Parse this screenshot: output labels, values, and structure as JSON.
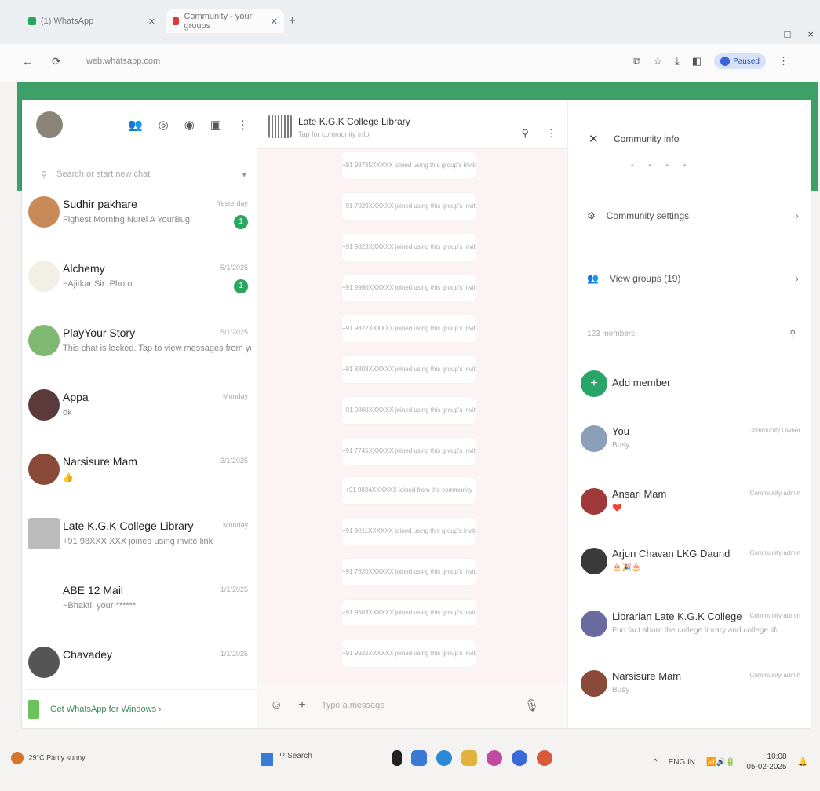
{
  "browser": {
    "tabs": [
      {
        "label": "(1) WhatsApp",
        "color": "#25a85c"
      },
      {
        "label": "Community - your groups",
        "color": "#d93a3a"
      }
    ],
    "new_tab": "+",
    "url": "web.whatsapp.com",
    "window_controls": [
      "–",
      "□",
      "×"
    ],
    "paused_label": "Paused"
  },
  "sidebar": {
    "search_placeholder": "Search or start new chat",
    "chats": [
      {
        "name": "Sudhir pakhare",
        "preview": "Fighest Morning Nurei A YourBug",
        "time": "Yesterday",
        "unread": "1",
        "avatar": "#c98a5a"
      },
      {
        "name": "Alchemy",
        "preview": "~Ajitkar Sir: Photo",
        "time": "5/1/2025",
        "unread": "1",
        "avatar": "#f2efe6"
      },
      {
        "name": "PlayYour Story",
        "preview": "This chat is locked. Tap to view messages from your system",
        "time": "5/1/2025",
        "unread": "",
        "avatar": "#7fb870"
      },
      {
        "name": "Appa",
        "preview": "ok",
        "time": "Monday",
        "unread": "",
        "avatar": "#5a3a3a"
      },
      {
        "name": "Narsisure Mam",
        "preview": "👍",
        "time": "3/1/2025",
        "unread": "",
        "avatar": "#8a4a3a"
      },
      {
        "name": "Late K.G.K College Library",
        "preview": "+91 98XXX XXX joined using invite link",
        "time": "Monday",
        "unread": "",
        "avatar": "#bbbbbb"
      },
      {
        "name": "ABE 12 Mail",
        "preview": "~Bhakti: your ******",
        "time": "1/1/2025",
        "unread": "",
        "avatar": "#ffffff"
      },
      {
        "name": "Chavadey",
        "preview": "",
        "time": "1/1/2025",
        "unread": "",
        "avatar": "#555555"
      }
    ],
    "get_app": "Get WhatsApp for Windows ›"
  },
  "conversation": {
    "title": "Late K.G.K College Library",
    "subtitle": "Tap for community info",
    "system_messages": [
      "+91 98765XXXXX joined using this group's invite link",
      "+91 7020XXXXXX joined using this group's invite link",
      "+91 9823XXXXXX joined using this group's invite link",
      "+91 9960XXXXXX joined using this group's invite link",
      "+91 9822XXXXXX joined using this group's invite link",
      "+91 8308XXXXXX joined using this group's invite link",
      "+91 9860XXXXXX joined using this group's invite link",
      "+91 7745XXXXXX joined using this group's invite link",
      "+91 9834XXXXXX joined from the community",
      "+91 9011XXXXXX joined using this group's invite link",
      "+91 7620XXXXXX joined using this group's invite link",
      "+91 9503XXXXXX joined using this group's invite link",
      "+91 9922XXXXXX joined using this group's invite link"
    ],
    "composer_placeholder": "Type a message"
  },
  "info_panel": {
    "title": "Community info",
    "settings_label": "Community settings",
    "view_groups_label": "View groups (19)",
    "members_count": "123 members",
    "add_member": "Add member",
    "members": [
      {
        "name": "You",
        "status": "Busy",
        "role": "Community Owner",
        "avatar": "#8aa0b8"
      },
      {
        "name": "Ansari Mam",
        "status": "❤️",
        "role": "Community admin",
        "avatar": "#a03a3a"
      },
      {
        "name": "Arjun Chavan LKG Daund",
        "status": "🎂🎉🎂",
        "role": "Community admin",
        "avatar": "#3a3a3a"
      },
      {
        "name": "Librarian Late K.G.K College",
        "status": "Fun fact about the college library and college life",
        "role": "Community admin",
        "avatar": "#6a6aa0"
      },
      {
        "name": "Narsisure Mam",
        "status": "Busy",
        "role": "Community admin",
        "avatar": "#8a4a3a"
      }
    ]
  },
  "taskbar": {
    "weather": "29°C Partly sunny",
    "search": "Search",
    "app_colors": [
      "#222222",
      "#3a79d4",
      "#2a8ad4",
      "#e2b23a",
      "#c04aa0",
      "#3a6ad8",
      "#d85a3a"
    ],
    "tray": "ENG IN",
    "time": "10:08",
    "date": "05-02-2025"
  }
}
